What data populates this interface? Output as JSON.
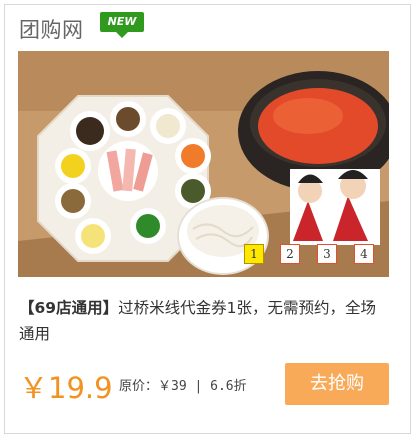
{
  "header": {
    "title": "团购网",
    "badge": "NEW"
  },
  "carousel": {
    "pages": [
      "1",
      "2",
      "3",
      "4"
    ],
    "active_page": "1",
    "image_subject": "food-photo"
  },
  "deal": {
    "tag": "【69店通用】",
    "description": "过桥米线代金券1张，无需预约，全场通用",
    "price": "￥19.9",
    "original_price_text": "原价：￥39 | 6.6折",
    "buy_label": "去抢购"
  },
  "colors": {
    "price": "#f29222",
    "buy_button": "#f9aa58",
    "badge": "#2f9a1e",
    "active_page": "#ffe800",
    "inactive_page_border": "#e0502a"
  }
}
